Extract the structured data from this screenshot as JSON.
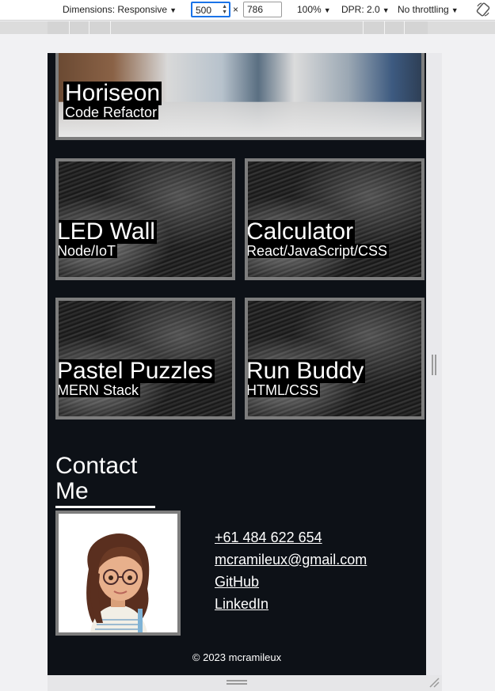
{
  "devtools": {
    "dimensions_label": "Dimensions: Responsive",
    "width": "500",
    "height": "786",
    "times": "×",
    "zoom": "100%",
    "dpr": "DPR: 2.0",
    "throttling": "No throttling",
    "rotate_icon": "rotate-icon"
  },
  "projects": [
    {
      "name": "Horiseon",
      "tech": "Code Refactor"
    },
    {
      "name": "LED Wall",
      "tech": "Node/IoT"
    },
    {
      "name": "Calculator",
      "tech": "React/JavaScript/CSS"
    },
    {
      "name": "Pastel Puzzles",
      "tech": "MERN Stack"
    },
    {
      "name": "Run Buddy",
      "tech": "HTML/CSS"
    }
  ],
  "contact": {
    "heading": "Contact Me",
    "phone": "+61 484 622 654",
    "email": "mcramileux@gmail.com",
    "github": "GitHub",
    "linkedin": "LinkedIn"
  },
  "footer": {
    "text": "© 2023 mcramileux"
  }
}
